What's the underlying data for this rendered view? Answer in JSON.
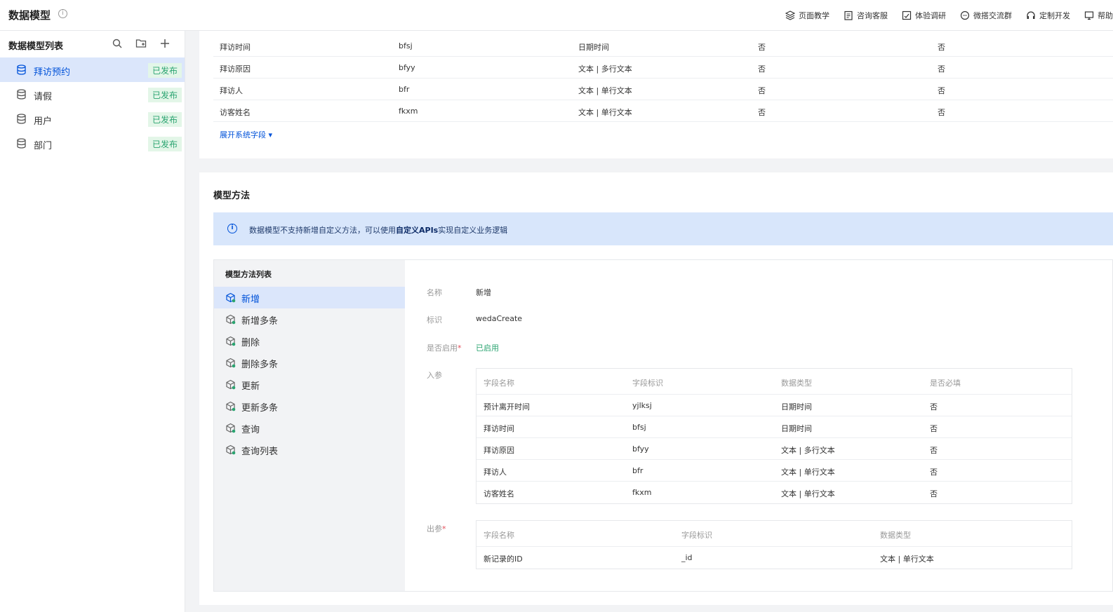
{
  "header": {
    "title": "数据模型",
    "nav": [
      {
        "label": "页面教学",
        "icon": "layers-icon"
      },
      {
        "label": "咨询客服",
        "icon": "clipboard-icon"
      },
      {
        "label": "体验调研",
        "icon": "survey-icon"
      },
      {
        "label": "微搭交流群",
        "icon": "chat-icon"
      },
      {
        "label": "定制开发",
        "icon": "headset-icon"
      },
      {
        "label": "帮助",
        "icon": "monitor-icon"
      }
    ]
  },
  "sidebar": {
    "title": "数据模型列表",
    "items": [
      {
        "name": "拜访预约",
        "status": "已发布"
      },
      {
        "name": "请假",
        "status": "已发布"
      },
      {
        "name": "用户",
        "status": "已发布"
      },
      {
        "name": "部门",
        "status": "已发布"
      }
    ]
  },
  "fields": {
    "rows": [
      [
        "拜访时间",
        "bfsj",
        "日期时间",
        "否",
        "否"
      ],
      [
        "拜访原因",
        "bfyy",
        "文本 | 多行文本",
        "否",
        "否"
      ],
      [
        "拜访人",
        "bfr",
        "文本 | 单行文本",
        "否",
        "否"
      ],
      [
        "访客姓名",
        "fkxm",
        "文本 | 单行文本",
        "否",
        "否"
      ]
    ],
    "expand_label": "展开系统字段 ▾"
  },
  "methods": {
    "section_title": "模型方法",
    "alert_prefix": "数据模型不支持新增自定义方法，可以使用",
    "alert_bold": "自定义APIs",
    "alert_suffix": "实现自定义业务逻辑",
    "list_title": "模型方法列表",
    "items": [
      "新增",
      "新增多条",
      "删除",
      "删除多条",
      "更新",
      "更新多条",
      "查询",
      "查询列表"
    ],
    "detail": {
      "name_label": "名称",
      "name_value": "新增",
      "id_label": "标识",
      "id_value": "wedaCreate",
      "enabled_label": "是否启用",
      "enabled_value": "已启用",
      "input_label": "入参",
      "output_label": "出参",
      "input_headers": [
        "字段名称",
        "字段标识",
        "数据类型",
        "是否必填"
      ],
      "input_rows": [
        [
          "预计离开时间",
          "yjlksj",
          "日期时间",
          "否"
        ],
        [
          "拜访时间",
          "bfsj",
          "日期时间",
          "否"
        ],
        [
          "拜访原因",
          "bfyy",
          "文本 | 多行文本",
          "否"
        ],
        [
          "拜访人",
          "bfr",
          "文本 | 单行文本",
          "否"
        ],
        [
          "访客姓名",
          "fkxm",
          "文本 | 单行文本",
          "否"
        ]
      ],
      "output_headers": [
        "字段名称",
        "字段标识",
        "数据类型"
      ],
      "output_rows": [
        [
          "新记录的ID",
          "_id",
          "文本 | 单行文本"
        ]
      ]
    }
  },
  "colors": {
    "accent": "#0052d9",
    "success": "#2ba471",
    "active_bg": "#dbe6fb"
  }
}
